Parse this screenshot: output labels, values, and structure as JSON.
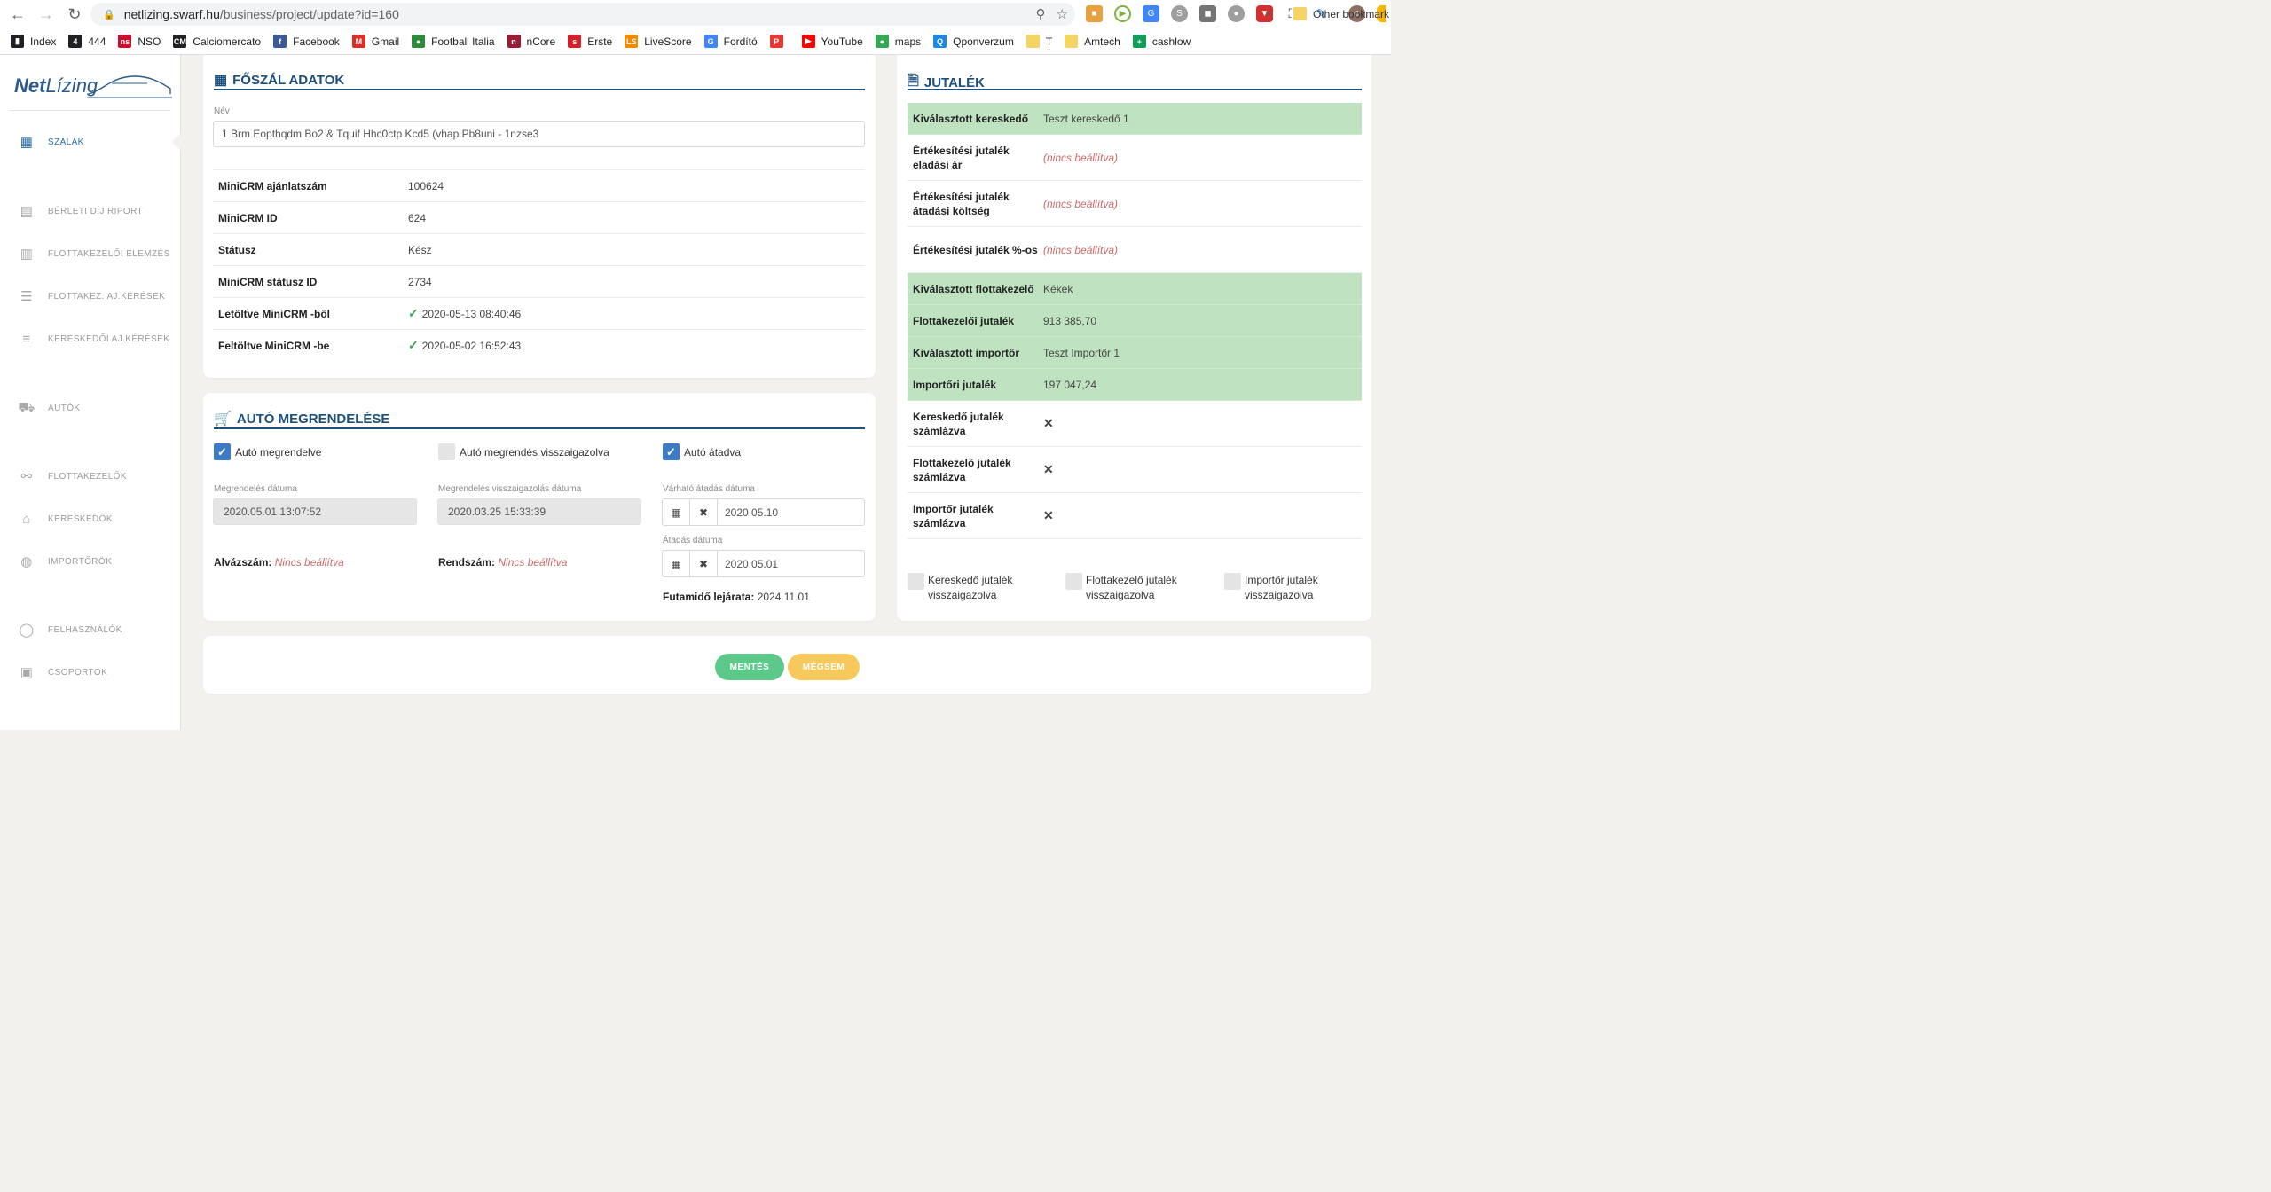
{
  "browser": {
    "url_host": "netlizing.swarf.hu",
    "url_path": "/business/project/update?id=160",
    "bookmarks": [
      {
        "label": "Index",
        "icon": "index-icon",
        "color": "#202124"
      },
      {
        "label": "444",
        "icon": "444-icon",
        "color": "#202124"
      },
      {
        "label": "NSO",
        "icon": "nso-icon",
        "color": "#c8102e"
      },
      {
        "label": "Calciomercato",
        "icon": "cm-icon",
        "color": "#202124"
      },
      {
        "label": "Facebook",
        "icon": "facebook-icon",
        "color": "#3b5998"
      },
      {
        "label": "Gmail",
        "icon": "gmail-icon",
        "color": "#d93025"
      },
      {
        "label": "Football Italia",
        "icon": "football-italia-icon",
        "color": "#2e8b3a"
      },
      {
        "label": "nCore",
        "icon": "ncore-icon",
        "color": "#9b1b30"
      },
      {
        "label": "Erste",
        "icon": "erste-icon",
        "color": "#d4202a"
      },
      {
        "label": "LiveScore",
        "icon": "livescore-icon",
        "color": "#f08a00"
      },
      {
        "label": "Fordító",
        "icon": "translate-icon",
        "color": "#4285f4"
      },
      {
        "label": "",
        "icon": "p-icon",
        "color": "#e53935"
      },
      {
        "label": "YouTube",
        "icon": "youtube-icon",
        "color": "#ff0000"
      },
      {
        "label": "maps",
        "icon": "maps-icon",
        "color": "#34a853"
      },
      {
        "label": "Qponverzum",
        "icon": "qponverzum-icon",
        "color": "#1e88e5"
      },
      {
        "label": "T",
        "icon": "folder-icon",
        "color": "#f6d365"
      },
      {
        "label": "Amtech",
        "icon": "folder-icon",
        "color": "#f6d365"
      },
      {
        "label": "cashlow",
        "icon": "sheets-icon",
        "color": "#0f9d58"
      }
    ],
    "more": "»",
    "other_bookmarks": "Other bookmark"
  },
  "sidebar": {
    "logo_bold": "Net",
    "logo_light": "Lízing",
    "items": [
      {
        "label": "SZÁLAK",
        "icon": "dashboard-icon"
      },
      {
        "label": "BÉRLETI DÍJ RIPORT",
        "icon": "report-icon"
      },
      {
        "label": "FLOTTAKEZELŐI ELEMZÉS",
        "icon": "bar-chart-icon"
      },
      {
        "label": "FLOTTAKEZ. AJ.KÉRÉSEK",
        "icon": "list-icon"
      },
      {
        "label": "KERESKEDŐI AJ.KÉRÉSEK",
        "icon": "list-bullets-icon"
      },
      {
        "label": "AUTÓK",
        "icon": "car-icon"
      },
      {
        "label": "FLOTTAKEZELŐK",
        "icon": "network-icon"
      },
      {
        "label": "KERESKEDŐK",
        "icon": "bank-icon"
      },
      {
        "label": "IMPORTŐRÖK",
        "icon": "globe-icon"
      },
      {
        "label": "FELHASZNÁLÓK",
        "icon": "user-icon"
      },
      {
        "label": "CSOPORTOK",
        "icon": "group-icon"
      }
    ]
  },
  "main": {
    "title": "FŐSZÁL ADATOK",
    "name_label": "Név",
    "name_value": "1 Brm Eopthqdm Bo2 & Tquif Hhc0ctp Kcd5 (vhap Pb8uni - 1nzse3",
    "rows": [
      {
        "label": "MiniCRM ajánlatszám",
        "value": "100624",
        "check": false
      },
      {
        "label": "MiniCRM ID",
        "value": "624",
        "check": false
      },
      {
        "label": "Státusz",
        "value": "Kész",
        "check": false
      },
      {
        "label": "MiniCRM státusz ID",
        "value": "2734",
        "check": false
      },
      {
        "label": "Letöltve MiniCRM -ből",
        "value": "2020-05-13 08:40:46",
        "check": true
      },
      {
        "label": "Feltöltve MiniCRM -be",
        "value": "2020-05-02 16:52:43",
        "check": true
      }
    ]
  },
  "order": {
    "title": "AUTÓ MEGRENDELÉSE",
    "cb_ordered": "Autó megrendelve",
    "cb_confirmed": "Autó megrendés visszaigazolva",
    "cb_delivered": "Autó átadva",
    "order_date_label": "Megrendelés dátuma",
    "order_date": "2020.05.01 13:07:52",
    "confirm_date_label": "Megrendelés visszaigazolás dátuma",
    "confirm_date": "2020.03.25 15:33:39",
    "expected_label": "Várható átadás dátuma",
    "expected_date": "2020.05.10",
    "handover_label": "Átadás dátuma",
    "handover_date": "2020.05.01",
    "chassis_label": "Alvázszám:",
    "chassis_value": "Nincs beállítva",
    "plate_label": "Rendszám:",
    "plate_value": "Nincs beállítva",
    "term_label": "Futamidő lejárata:",
    "term_value": "2024.11.01"
  },
  "commission": {
    "title": "JUTALÉK",
    "rows": [
      {
        "label": "Kiválasztott kereskedő",
        "value": "Teszt kereskedő 1",
        "type": "text",
        "green": true
      },
      {
        "label": "Értékesítési jutalék eladási ár",
        "value": "(nincs beállítva)",
        "type": "unset",
        "green": false
      },
      {
        "label": "Értékesítési jutalék átadási költség",
        "value": "(nincs beállítva)",
        "type": "unset",
        "green": false
      },
      {
        "label": "Értékesítési jutalék %-os",
        "value": "(nincs beállítva)",
        "type": "unset",
        "green": false
      },
      {
        "label": "Kiválasztott flottakezelő",
        "value": "Kékek",
        "type": "text",
        "green": true
      },
      {
        "label": "Flottakezelői jutalék",
        "value": "913 385,70",
        "type": "text",
        "green": true
      },
      {
        "label": "Kiválasztott importőr",
        "value": "Teszt Importőr 1",
        "type": "text",
        "green": true
      },
      {
        "label": "Importőri jutalék",
        "value": "197 047,24",
        "type": "text",
        "green": true
      },
      {
        "label": "Kereskedő jutalék számlázva",
        "value": "✕",
        "type": "x",
        "green": false
      },
      {
        "label": "Flottakezelő jutalék számlázva",
        "value": "✕",
        "type": "x",
        "green": false
      },
      {
        "label": "Importőr jutalék számlázva",
        "value": "✕",
        "type": "x",
        "green": false
      }
    ],
    "cb_dealer": "Kereskedő jutalék visszaigazolva",
    "cb_fleet": "Flottakezelő jutalék visszaigazolva",
    "cb_importer": "Importőr jutalék visszaigazolva"
  },
  "actions": {
    "save": "MENTÉS",
    "cancel": "MÉGSEM",
    "save_color": "#5cc98a",
    "cancel_color": "#f7c85c"
  }
}
